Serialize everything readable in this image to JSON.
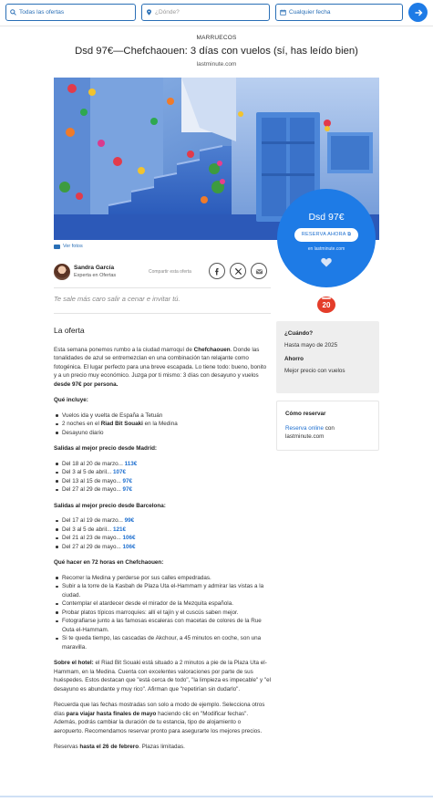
{
  "search": {
    "what_placeholder": "Todas las ofertas",
    "where_placeholder": "¿Dónde?",
    "when_placeholder": "Cualquier fecha"
  },
  "header": {
    "kicker": "MARRUECOS",
    "title": "Dsd 97€—Chefchaouen: 3 días con vuelos (sí, has leído bien)",
    "source": "lastminute.com"
  },
  "hero": {
    "photo_credit": "Ver fotos"
  },
  "price_card": {
    "price": "Dsd 97€",
    "cta": "RESERVA AHORA",
    "site": "en lastminute.com"
  },
  "author": {
    "name": "Sandra García",
    "role": "Experta en Ofertas",
    "share_label": "Compartir esta oferta"
  },
  "quote": "Te sale más caro salir a cenar e invitar tú.",
  "badge": "20",
  "article": {
    "heading": "La oferta",
    "intro_1": "Esta semana ponemos rumbo a la ciudad marroquí de ",
    "intro_city": "Chefchaouen",
    "intro_2": ". Donde las tonalidades de azul se entremezclan en una combinación tan relajante como fotogénica. El lugar perfecto para una breve escapada. Lo tiene todo: bueno, bonito y a un precio muy económico. Juzga por ti mismo: 3 días con desayuno y vuelos ",
    "intro_price": "desde 97€ por persona.",
    "includes_title": "Qué incluye:",
    "includes": [
      {
        "pre": "Vuelos ida y vuelta de España a Tetuán",
        "bold": "",
        "post": ""
      },
      {
        "pre": "2 noches en el ",
        "bold": "Riad Bit Souaki",
        "post": " en la Medina"
      },
      {
        "pre": "Desayuno diario",
        "bold": "",
        "post": ""
      }
    ],
    "madrid_title": "Salidas al mejor precio desde Madrid:",
    "madrid": [
      {
        "text": "Del 18 al 20 de marzo... ",
        "price": "113€"
      },
      {
        "text": "Del 3 al 5 de abril... ",
        "price": "107€"
      },
      {
        "text": "Del 13 al 15 de mayo... ",
        "price": "97€"
      },
      {
        "text": "Del 27 al 29 de mayo... ",
        "price": "97€"
      }
    ],
    "barcelona_title": "Salidas al mejor precio desde Barcelona:",
    "barcelona": [
      {
        "text": "Del 17 al 19 de marzo... ",
        "price": "99€"
      },
      {
        "text": "Del 3 al 5 de abril... ",
        "price": "121€"
      },
      {
        "text": "Del 21 al 23 de mayo... ",
        "price": "106€"
      },
      {
        "text": "Del 27 al 29 de mayo... ",
        "price": "106€"
      }
    ],
    "todo_title": "Qué hacer en 72 horas en Chefchaouen:",
    "todo": [
      "Recorrer la Medina y perderse por sus calles empedradas.",
      "Subir a la torre de la Kasbah de Plaza Uta el-Hammam y admirar las vistas a la ciudad.",
      "Contemplar el atardecer desde el mirador de la Mezquita española.",
      "Probar platos típicos marroquíes: allí el tajín y el cuscús saben mejor.",
      "Fotografiarse junto a las famosas escaleras con macetas de colores de la Rue Outa el-Hammam.",
      "Si te queda tiempo, las cascadas de Akchour, a 45 minutos en coche, son una maravilla."
    ],
    "hotel_label": "Sobre el hotel:",
    "hotel_text": " el Riad Bit Souaki está situado a 2 minutos a pie de la Plaza Uta el-Hammam, en la Medina. Cuenta con excelentes valoraciones por parte de sus huéspedes. Estos destacan que \"está cerca de todo\", \"la limpieza es impecable\" y \"el desayuno es abundante y muy rico\". Afirman que \"repetirían sin dudarlo\".",
    "note_1": "Recuerda que las fechas mostradas son solo a modo de ejemplo. Selecciona otros días ",
    "note_bold": "para viajar hasta finales de mayo",
    "note_2": " haciendo clic en \"Modificar fechas\". Además, podrás cambiar la duración de tu estancia, tipo de alojamiento o aeropuerto. Recomendamos reservar pronto para asegurarte los mejores precios.",
    "deadline_1": "Reservas ",
    "deadline_bold": "hasta el 26 de febrero",
    "deadline_2": ". Plazas limitadas."
  },
  "sidebar": {
    "when_label": "¿Cuándo?",
    "when_value": "Hasta mayo de 2025",
    "saving_label": "Ahorro",
    "saving_value": "Mejor precio con vuelos",
    "book_label": "Cómo reservar",
    "book_link": "Reserva online",
    "book_rest": " con lastminute.com"
  },
  "colors": {
    "accent": "#1e7be6",
    "link": "#1e6fcf",
    "badge": "#e43d2a"
  }
}
